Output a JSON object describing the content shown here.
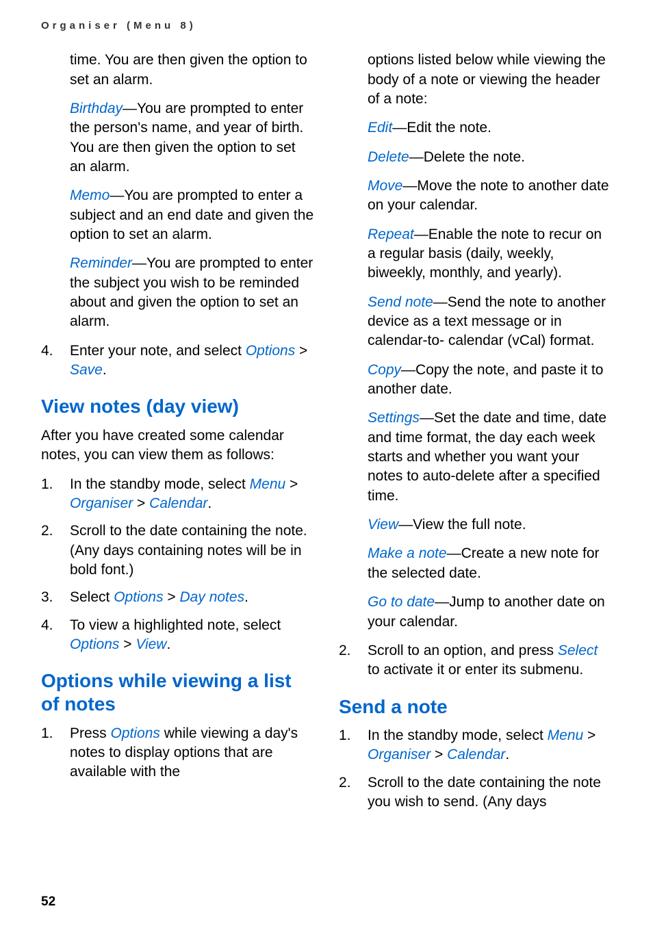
{
  "header": "Organiser (Menu 8)",
  "col1": {
    "p1": "time. You are then given the option to set an alarm.",
    "birthday_label": "Birthday",
    "birthday_rest": "—You are prompted to enter the person's name, and year of birth. You are then given the option to set an alarm.",
    "memo_label": "Memo",
    "memo_rest": "—You are prompted to enter a subject and an end date and given the option to set an alarm.",
    "reminder_label": "Reminder",
    "reminder_rest": "—You are prompted to enter the subject you wish to be reminded about and given the option to set an alarm.",
    "step4_num": "4.",
    "step4_a": "Enter your note, and select ",
    "step4_opt": "Options",
    "step4_gt": " > ",
    "step4_save": "Save",
    "step4_end": ".",
    "h_view": "View notes (day view)",
    "view_intro": "After you have created some calendar notes, you can view them as follows:",
    "v1_num": "1.",
    "v1_a": "In the standby mode, select ",
    "v1_menu": "Menu",
    "v1_gt1": " > ",
    "v1_org": "Organiser",
    "v1_gt2": " > ",
    "v1_cal": "Calendar",
    "v1_end": ".",
    "v2_num": "2.",
    "v2_txt": "Scroll to the date containing the note. (Any days containing notes will be in bold font.)",
    "v3_num": "3.",
    "v3_a": "Select ",
    "v3_opt": "Options",
    "v3_gt": " > ",
    "v3_day": "Day notes",
    "v3_end": ".",
    "v4_num": "4.",
    "v4_a": "To view a highlighted note, select ",
    "v4_opt": "Options",
    "v4_gt": " > ",
    "v4_view": "View",
    "v4_end": ".",
    "h_options": "Options while viewing a list of notes",
    "o1_num": "1.",
    "o1_a": "Press ",
    "o1_opt": "Options",
    "o1_b": " while viewing a day's notes to display options that are available with the"
  },
  "col2": {
    "top": "options listed below while viewing the body of a note or viewing the header of a note:",
    "edit_l": "Edit",
    "edit_r": "—Edit the note.",
    "delete_l": "Delete",
    "delete_r": "—Delete the note.",
    "move_l": "Move",
    "move_r": "—Move the note to another date on your calendar.",
    "repeat_l": "Repeat",
    "repeat_r": "—Enable the note to recur on a regular basis (daily, weekly, biweekly, monthly, and yearly).",
    "send_l": "Send note",
    "send_r": "—Send the note to another device as a text message or in calendar-to- calendar (vCal) format.",
    "copy_l": "Copy",
    "copy_r": "—Copy the note, and paste it to another date.",
    "set_l": "Settings",
    "set_r": "—Set the date and time, date and time format, the day each week starts and whether you want your notes to auto-delete after a specified time.",
    "view_l": "View",
    "view_r": "—View the full note.",
    "make_l": "Make a note",
    "make_r": "—Create a new note for the selected date.",
    "goto_l": "Go to date",
    "goto_r": "—Jump to another date on your calendar.",
    "s2_num": "2.",
    "s2_a": "Scroll to an option, and press ",
    "s2_sel": "Select",
    "s2_b": " to activate it or enter its submenu.",
    "h_send": "Send a note",
    "sn1_num": "1.",
    "sn1_a": "In the standby mode, select ",
    "sn1_menu": "Menu",
    "sn1_gt1": " > ",
    "sn1_org": "Organiser",
    "sn1_gt2": " > ",
    "sn1_cal": "Calendar",
    "sn1_end": ".",
    "sn2_num": "2.",
    "sn2_txt": "Scroll to the date containing the note you wish to send. (Any days"
  },
  "pagenum": "52"
}
